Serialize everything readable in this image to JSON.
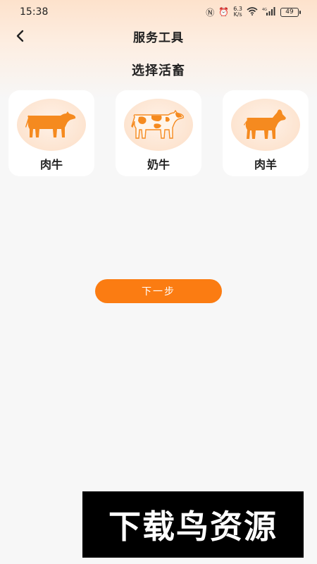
{
  "status_bar": {
    "time": "15:38",
    "speed_top": "6.3",
    "speed_bottom": "K/s",
    "signal_label": "4G",
    "battery": "49"
  },
  "nav": {
    "back_icon": "chevron-left-icon",
    "title": "服务工具"
  },
  "section_title": "选择活畜",
  "animals": [
    {
      "label": "肉牛",
      "icon": "beef-cattle-icon",
      "color": "#f58a1f"
    },
    {
      "label": "奶牛",
      "icon": "dairy-cow-icon",
      "color": "#f58a1f"
    },
    {
      "label": "肉羊",
      "icon": "sheep-icon",
      "color": "#f58a1f"
    }
  ],
  "next_button": {
    "label": "下一步",
    "color": "#fb7c12"
  },
  "watermark": "下载鸟资源"
}
